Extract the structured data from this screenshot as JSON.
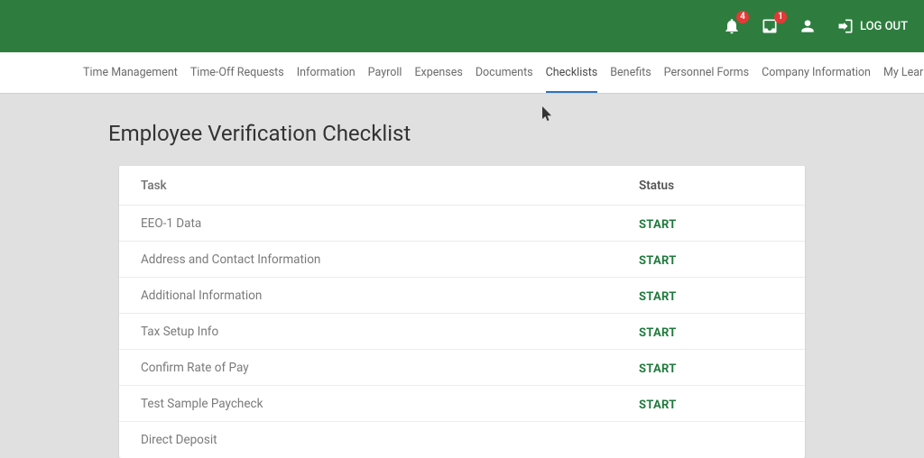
{
  "header": {
    "notifications_badge": "4",
    "inbox_badge": "1",
    "logout_label": "LOG OUT"
  },
  "nav": {
    "items": [
      "Time Management",
      "Time-Off Requests",
      "Information",
      "Payroll",
      "Expenses",
      "Documents",
      "Checklists",
      "Benefits",
      "Personnel Forms",
      "Company Information",
      "My Learning"
    ],
    "active_index": 6
  },
  "page": {
    "title": "Employee Verification Checklist",
    "columns": {
      "task": "Task",
      "status": "Status"
    },
    "rows": [
      {
        "task": "EEO-1 Data",
        "status": "START"
      },
      {
        "task": "Address and Contact Information",
        "status": "START"
      },
      {
        "task": "Additional Information",
        "status": "START"
      },
      {
        "task": "Tax Setup Info",
        "status": "START"
      },
      {
        "task": "Confirm Rate of Pay",
        "status": "START"
      },
      {
        "task": "Test Sample Paycheck",
        "status": "START"
      },
      {
        "task": "Direct Deposit",
        "status": ""
      }
    ]
  }
}
